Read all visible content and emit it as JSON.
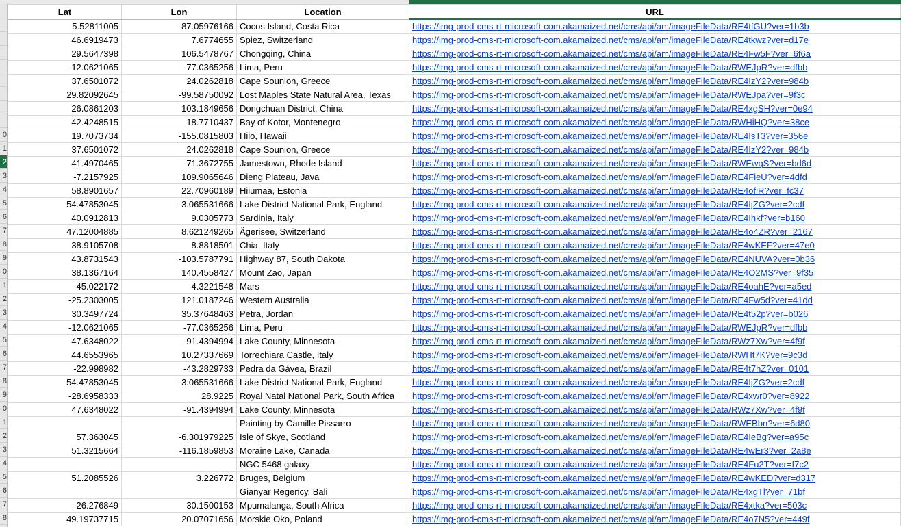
{
  "columns": [
    "Lat",
    "Lon",
    "Location",
    "URL"
  ],
  "row_numbers": [
    "",
    "",
    "",
    "",
    "",
    "",
    "",
    "",
    "0",
    "1",
    "2",
    "3",
    "4",
    "5",
    "6",
    "7",
    "8",
    "9",
    "0",
    "1",
    "2",
    "3",
    "4",
    "5",
    "6",
    "7",
    "8",
    "9",
    "0",
    "1",
    "2",
    "3",
    "4",
    "5",
    "6",
    "7",
    "8"
  ],
  "rows": [
    [
      "5.52811005",
      "-87.05976166",
      "Cocos Island, Costa Rica",
      "https://img-prod-cms-rt-microsoft-com.akamaized.net/cms/api/am/imageFileData/RE4tfGU?ver=1b3b"
    ],
    [
      "46.6919473",
      "7.6774655",
      "Spiez, Switzerland",
      "https://img-prod-cms-rt-microsoft-com.akamaized.net/cms/api/am/imageFileData/RE4tkwz?ver=d17e"
    ],
    [
      "29.5647398",
      "106.5478767",
      "Chongqing, China",
      "https://img-prod-cms-rt-microsoft-com.akamaized.net/cms/api/am/imageFileData/RE4Fw5F?ver=6f6a"
    ],
    [
      "-12.0621065",
      "-77.0365256",
      "Lima, Peru",
      "https://img-prod-cms-rt-microsoft-com.akamaized.net/cms/api/am/imageFileData/RWEJpR?ver=dfbb"
    ],
    [
      "37.6501072",
      "24.0262818",
      "Cape Sounion, Greece",
      "https://img-prod-cms-rt-microsoft-com.akamaized.net/cms/api/am/imageFileData/RE4IzY2?ver=984b"
    ],
    [
      "29.82092645",
      "-99.58750092",
      "Lost Maples State Natural Area, Texas",
      "https://img-prod-cms-rt-microsoft-com.akamaized.net/cms/api/am/imageFileData/RWEJpa?ver=9f3c"
    ],
    [
      "26.0861203",
      "103.1849656",
      "Dongchuan District, China",
      "https://img-prod-cms-rt-microsoft-com.akamaized.net/cms/api/am/imageFileData/RE4xgSH?ver=0e94"
    ],
    [
      "42.4248515",
      "18.7710437",
      "Bay of Kotor, Montenegro",
      "https://img-prod-cms-rt-microsoft-com.akamaized.net/cms/api/am/imageFileData/RWHiHQ?ver=38ce"
    ],
    [
      "19.7073734",
      "-155.0815803",
      "Hilo, Hawaii",
      "https://img-prod-cms-rt-microsoft-com.akamaized.net/cms/api/am/imageFileData/RE4IsT3?ver=356e"
    ],
    [
      "37.6501072",
      "24.0262818",
      "Cape Sounion, Greece",
      "https://img-prod-cms-rt-microsoft-com.akamaized.net/cms/api/am/imageFileData/RE4IzY2?ver=984b"
    ],
    [
      "41.4970465",
      "-71.3672755",
      "Jamestown, Rhode Island",
      "https://img-prod-cms-rt-microsoft-com.akamaized.net/cms/api/am/imageFileData/RWEwqS?ver=bd6d"
    ],
    [
      "-7.2157925",
      "109.9065646",
      "Dieng Plateau, Java",
      "https://img-prod-cms-rt-microsoft-com.akamaized.net/cms/api/am/imageFileData/RE4FieU?ver=4dfd"
    ],
    [
      "58.8901657",
      "22.70960189",
      "Hiiumaa, Estonia",
      "https://img-prod-cms-rt-microsoft-com.akamaized.net/cms/api/am/imageFileData/RE4ofiR?ver=fc37"
    ],
    [
      "54.47853045",
      "-3.065531666",
      "Lake District National Park, England",
      "https://img-prod-cms-rt-microsoft-com.akamaized.net/cms/api/am/imageFileData/RE4IjZG?ver=2cdf"
    ],
    [
      "40.0912813",
      "9.0305773",
      "Sardinia, Italy",
      "https://img-prod-cms-rt-microsoft-com.akamaized.net/cms/api/am/imageFileData/RE4Ihkf?ver=b160"
    ],
    [
      "47.12004885",
      "8.621249265",
      "Ägerisee, Switzerland",
      "https://img-prod-cms-rt-microsoft-com.akamaized.net/cms/api/am/imageFileData/RE4o4ZR?ver=2167"
    ],
    [
      "38.9105708",
      "8.8818501",
      "Chia, Italy",
      "https://img-prod-cms-rt-microsoft-com.akamaized.net/cms/api/am/imageFileData/RE4wKEF?ver=47e0"
    ],
    [
      "43.8731543",
      "-103.5787791",
      "Highway 87, South Dakota",
      "https://img-prod-cms-rt-microsoft-com.akamaized.net/cms/api/am/imageFileData/RE4NUVA?ver=0b36"
    ],
    [
      "38.1367164",
      "140.4558427",
      "Mount Zaō, Japan",
      "https://img-prod-cms-rt-microsoft-com.akamaized.net/cms/api/am/imageFileData/RE4O2MS?ver=9f35"
    ],
    [
      "45.022172",
      "4.3221548",
      "Mars",
      "https://img-prod-cms-rt-microsoft-com.akamaized.net/cms/api/am/imageFileData/RE4oahE?ver=a5ed"
    ],
    [
      "-25.2303005",
      "121.0187246",
      "Western Australia",
      "https://img-prod-cms-rt-microsoft-com.akamaized.net/cms/api/am/imageFileData/RE4Fw5d?ver=41dd"
    ],
    [
      "30.3497724",
      "35.37648463",
      "Petra, Jordan",
      "https://img-prod-cms-rt-microsoft-com.akamaized.net/cms/api/am/imageFileData/RE4t52p?ver=b026"
    ],
    [
      "-12.0621065",
      "-77.0365256",
      "Lima, Peru",
      "https://img-prod-cms-rt-microsoft-com.akamaized.net/cms/api/am/imageFileData/RWEJpR?ver=dfbb"
    ],
    [
      "47.6348022",
      "-91.4394994",
      "Lake County, Minnesota",
      "https://img-prod-cms-rt-microsoft-com.akamaized.net/cms/api/am/imageFileData/RWz7Xw?ver=4f9f"
    ],
    [
      "44.6553965",
      "10.27337669",
      "Torrechiara Castle, Italy",
      "https://img-prod-cms-rt-microsoft-com.akamaized.net/cms/api/am/imageFileData/RWHt7K?ver=9c3d"
    ],
    [
      "-22.998982",
      "-43.2829733",
      "Pedra da Gávea, Brazil",
      "https://img-prod-cms-rt-microsoft-com.akamaized.net/cms/api/am/imageFileData/RE4t7hZ?ver=0101"
    ],
    [
      "54.47853045",
      "-3.065531666",
      "Lake District National Park, England",
      "https://img-prod-cms-rt-microsoft-com.akamaized.net/cms/api/am/imageFileData/RE4IjZG?ver=2cdf"
    ],
    [
      "-28.6958333",
      "28.9225",
      "Royal Natal National Park, South Africa",
      "https://img-prod-cms-rt-microsoft-com.akamaized.net/cms/api/am/imageFileData/RE4xwr0?ver=8922"
    ],
    [
      "47.6348022",
      "-91.4394994",
      "Lake County, Minnesota",
      "https://img-prod-cms-rt-microsoft-com.akamaized.net/cms/api/am/imageFileData/RWz7Xw?ver=4f9f"
    ],
    [
      "",
      "",
      "Painting by Camille Pissarro",
      "https://img-prod-cms-rt-microsoft-com.akamaized.net/cms/api/am/imageFileData/RWEBbn?ver=6d80"
    ],
    [
      "57.363045",
      "-6.301979225",
      "Isle of Skye, Scotland",
      "https://img-prod-cms-rt-microsoft-com.akamaized.net/cms/api/am/imageFileData/RE4IeBg?ver=a95c"
    ],
    [
      "51.3215664",
      "-116.1859853",
      "Moraine Lake, Canada",
      "https://img-prod-cms-rt-microsoft-com.akamaized.net/cms/api/am/imageFileData/RE4wEr3?ver=2a8e"
    ],
    [
      "",
      "",
      "NGC 5468 galaxy",
      "https://img-prod-cms-rt-microsoft-com.akamaized.net/cms/api/am/imageFileData/RE4Fu2T?ver=f7c2"
    ],
    [
      "51.2085526",
      "3.226772",
      "Bruges, Belgium",
      "https://img-prod-cms-rt-microsoft-com.akamaized.net/cms/api/am/imageFileData/RE4wKED?ver=d317"
    ],
    [
      "",
      "",
      "Gianyar Regency, Bali",
      "https://img-prod-cms-rt-microsoft-com.akamaized.net/cms/api/am/imageFileData/RE4xgTl?ver=71bf"
    ],
    [
      "-26.276849",
      "30.1500153",
      "Mpumalanga, South Africa",
      "https://img-prod-cms-rt-microsoft-com.akamaized.net/cms/api/am/imageFileData/RE4xtka?ver=503c"
    ],
    [
      "49.19737715",
      "20.07071656",
      "Morskie Oko, Poland",
      "https://img-prod-cms-rt-microsoft-com.akamaized.net/cms/api/am/imageFileData/RE4o7N5?ver=449f"
    ]
  ],
  "colors": {
    "selection_green": "#1e7145",
    "link_blue": "#0b3fc7",
    "header_gray": "#e6e6e6"
  }
}
